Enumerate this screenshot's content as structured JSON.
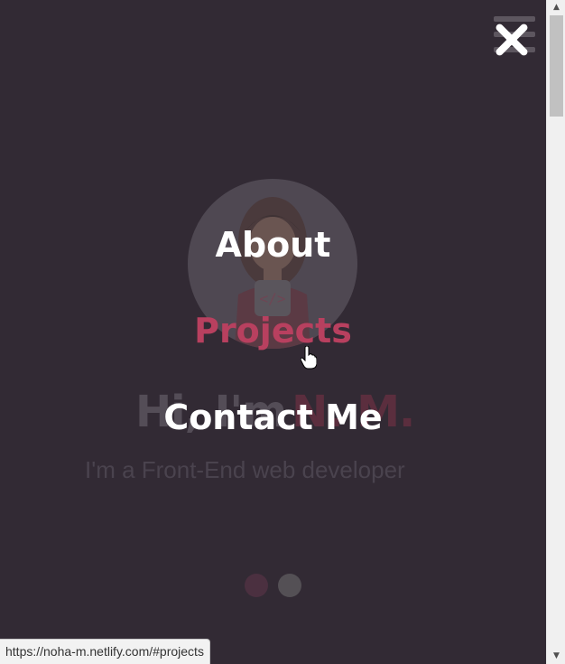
{
  "hero": {
    "greeting": "Hi, I'm",
    "name": "N. M.",
    "subtitle": "I'm a Front-End web developer",
    "avatar_code": "</>"
  },
  "menu": {
    "items": [
      {
        "label": "About"
      },
      {
        "label": "Projects"
      },
      {
        "label": "Contact Me"
      }
    ],
    "active_index": 1
  },
  "icons": {
    "close": "close-icon",
    "hamburger": "hamburger-icon",
    "cursor": "hand-cursor-icon"
  },
  "status_bar": {
    "url": "https://noha-m.netlify.com/#projects"
  },
  "carousel": {
    "dots": 2,
    "active": 0
  },
  "colors": {
    "background": "#322a34",
    "accent": "#b8405f",
    "menu_text": "#ffffff"
  }
}
